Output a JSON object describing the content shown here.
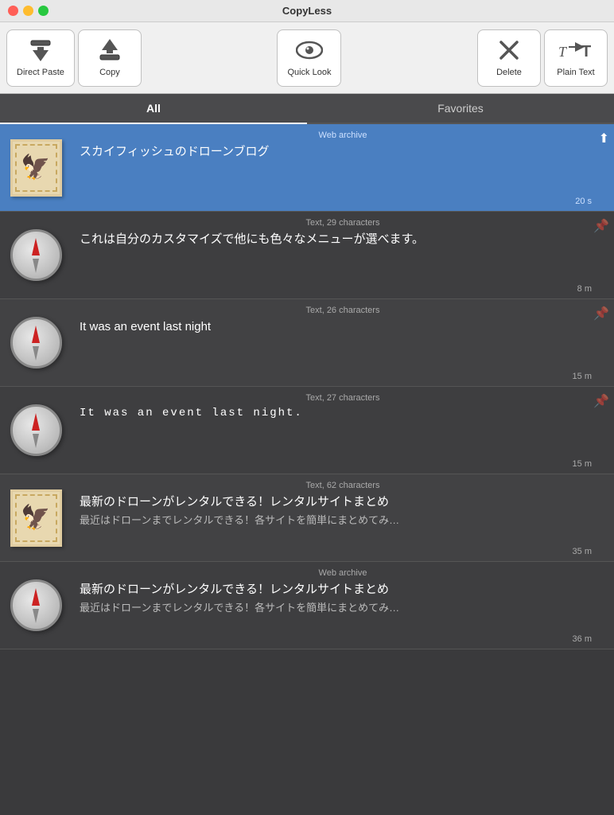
{
  "app": {
    "title": "CopyLess"
  },
  "toolbar": {
    "buttons": [
      {
        "id": "direct-paste",
        "label": "Direct Paste",
        "icon": "⬇"
      },
      {
        "id": "copy",
        "label": "Copy",
        "icon": "⬆"
      },
      {
        "id": "quick-look",
        "label": "Quick Look",
        "icon": "👁"
      },
      {
        "id": "delete",
        "label": "Delete",
        "icon": "✕"
      },
      {
        "id": "plain-text",
        "label": "Plain Text",
        "icon": "T→T"
      }
    ]
  },
  "tabs": [
    {
      "id": "all",
      "label": "All",
      "active": true
    },
    {
      "id": "favorites",
      "label": "Favorites",
      "active": false
    }
  ],
  "clips": [
    {
      "id": 1,
      "selected": true,
      "thumb": "stamp",
      "meta": "Web archive",
      "title": "スカイフィッシュのドローンブログ",
      "preview": "",
      "time": "20 s",
      "action": "upload"
    },
    {
      "id": 2,
      "selected": false,
      "thumb": "compass",
      "meta": "Text, 29 characters",
      "title": "これは自分のカスタマイズで他にも色々なメニューが選べます。",
      "preview": "",
      "time": "8 m",
      "action": "pin"
    },
    {
      "id": 3,
      "selected": false,
      "thumb": "compass",
      "meta": "Text, 26 characters",
      "title": "It was an event last night",
      "preview": "",
      "time": "15 m",
      "action": "pin"
    },
    {
      "id": 4,
      "selected": false,
      "thumb": "compass",
      "meta": "Text, 27 characters",
      "title": "It  was  an  event  last  night.",
      "preview": "",
      "time": "15 m",
      "action": "pin",
      "mono": true
    },
    {
      "id": 5,
      "selected": false,
      "thumb": "stamp",
      "meta": "Text, 62 characters",
      "title": "最新のドローンがレンタルできる！レンタルサイトまとめ",
      "preview": "最近はドローンまでレンタルできる！各サイトを簡単にまとめてみ…",
      "time": "35 m",
      "action": ""
    },
    {
      "id": 6,
      "selected": false,
      "thumb": "compass",
      "meta": "Web archive",
      "title": "最新のドローンがレンタルできる！レンタルサイトまとめ",
      "preview": "最近はドローンまでレンタルできる！各サイトを簡単にまとめてみ…",
      "time": "36 m",
      "action": ""
    }
  ]
}
